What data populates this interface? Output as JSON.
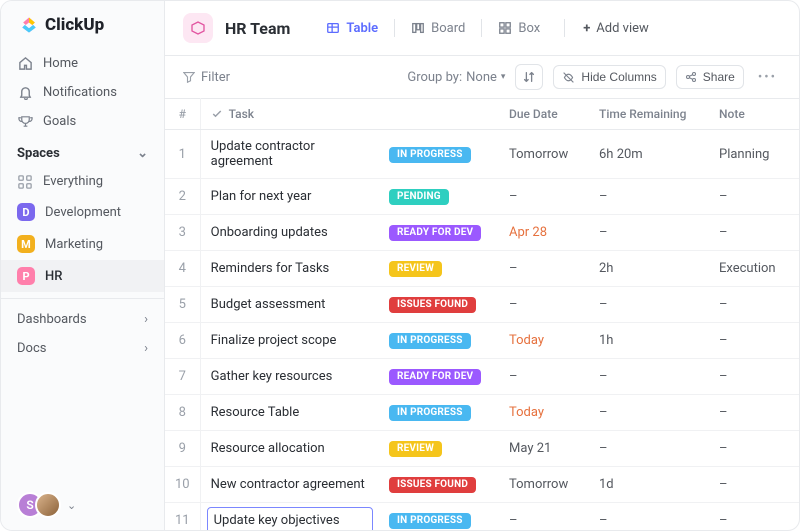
{
  "brand": "ClickUp",
  "nav": [
    {
      "icon": "home",
      "label": "Home"
    },
    {
      "icon": "bell",
      "label": "Notifications"
    },
    {
      "icon": "trophy",
      "label": "Goals"
    }
  ],
  "spaces_header": "Spaces",
  "everything_label": "Everything",
  "spaces": [
    {
      "letter": "D",
      "label": "Development",
      "color": "#7b68ee"
    },
    {
      "letter": "M",
      "label": "Marketing",
      "color": "#f2b01e"
    },
    {
      "letter": "P",
      "label": "HR",
      "color": "#ff7fab",
      "active": true
    }
  ],
  "sections": [
    {
      "label": "Dashboards"
    },
    {
      "label": "Docs"
    }
  ],
  "footer": {
    "initial": "S"
  },
  "header": {
    "title": "HR Team",
    "views": [
      {
        "name": "Table",
        "icon": "table",
        "active": true
      },
      {
        "name": "Board",
        "icon": "board"
      },
      {
        "name": "Box",
        "icon": "box"
      }
    ],
    "add_view": "Add view"
  },
  "toolbar": {
    "filter_label": "Filter",
    "groupby_label": "Group by:",
    "groupby_value": "None",
    "hide_columns": "Hide Columns",
    "share": "Share"
  },
  "columns": {
    "num": "#",
    "task": "Task",
    "due": "Due Date",
    "time": "Time Remaining",
    "note": "Note"
  },
  "status_colors": {
    "IN PROGRESS": "#49b8f1",
    "PENDING": "#2ecfc0",
    "READY FOR DEV": "#9b59ff",
    "REVIEW": "#f5c51b",
    "ISSUES FOUND": "#e03e3e"
  },
  "rows": [
    {
      "n": 1,
      "task": "Update contractor agreement",
      "status": "IN PROGRESS",
      "due": "Tomorrow",
      "due_accent": false,
      "time": "6h 20m",
      "note": "Planning"
    },
    {
      "n": 2,
      "task": "Plan for next year",
      "status": "PENDING",
      "due": "–",
      "due_accent": false,
      "time": "–",
      "note": "–"
    },
    {
      "n": 3,
      "task": "Onboarding updates",
      "status": "READY FOR DEV",
      "due": "Apr 28",
      "due_accent": true,
      "time": "–",
      "note": "–"
    },
    {
      "n": 4,
      "task": "Reminders for Tasks",
      "status": "REVIEW",
      "due": "–",
      "due_accent": false,
      "time": "2h",
      "note": "Execution"
    },
    {
      "n": 5,
      "task": "Budget assessment",
      "status": "ISSUES FOUND",
      "due": "–",
      "due_accent": false,
      "time": "–",
      "note": "–"
    },
    {
      "n": 6,
      "task": "Finalize project scope",
      "status": "IN PROGRESS",
      "due": "Today",
      "due_accent": true,
      "time": "1h",
      "note": "–"
    },
    {
      "n": 7,
      "task": "Gather key resources",
      "status": "READY FOR DEV",
      "due": "–",
      "due_accent": false,
      "time": "–",
      "note": "–"
    },
    {
      "n": 8,
      "task": "Resource Table",
      "status": "IN PROGRESS",
      "due": "Today",
      "due_accent": true,
      "time": "–",
      "note": "–"
    },
    {
      "n": 9,
      "task": "Resource allocation",
      "status": "REVIEW",
      "due": "May 21",
      "due_accent": false,
      "time": "–",
      "note": "–"
    },
    {
      "n": 10,
      "task": "New contractor agreement",
      "status": "ISSUES FOUND",
      "due": "Tomorrow",
      "due_accent": false,
      "time": "1d",
      "note": "–"
    },
    {
      "n": 11,
      "task": "Update key objectives",
      "status": "IN PROGRESS",
      "due": "–",
      "due_accent": false,
      "time": "–",
      "note": "–",
      "editing": true
    }
  ]
}
